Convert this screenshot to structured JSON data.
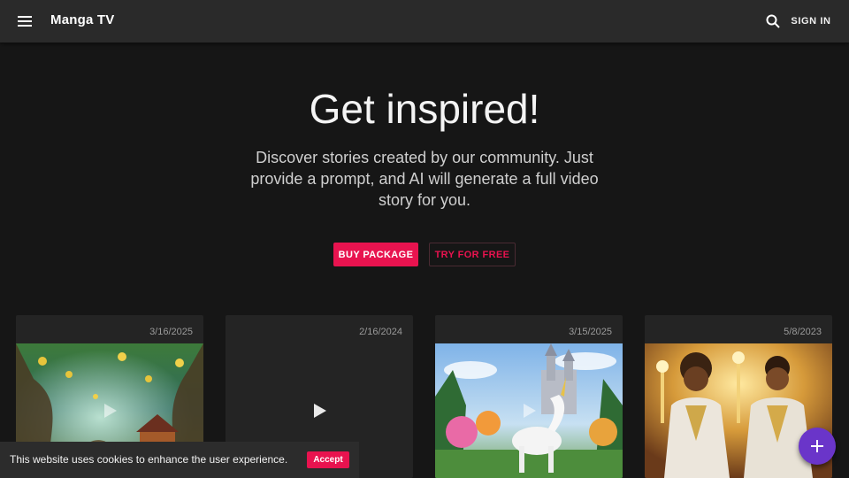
{
  "header": {
    "title": "Manga TV",
    "menu_icon": "menu-icon",
    "search_icon": "search-icon",
    "signin_label": "SIGN IN"
  },
  "hero": {
    "title": "Get inspired!",
    "subtitle": "Discover stories created by our community. Just provide a prompt, and AI will generate a full video story for you.",
    "buy_label": "BUY PACKAGE",
    "try_label": "TRY FOR FREE"
  },
  "cards": [
    {
      "date": "3/16/2025",
      "thumbnail": "enchanted-forest"
    },
    {
      "date": "2/16/2024",
      "thumbnail": "empty"
    },
    {
      "date": "3/15/2025",
      "thumbnail": "unicorn-castle"
    },
    {
      "date": "5/8/2023",
      "thumbnail": "two-warriors"
    }
  ],
  "cookie": {
    "text": "This website uses cookies to enhance the user experience.",
    "accept_label": "Accept"
  },
  "fab": {
    "icon": "plus-icon"
  },
  "colors": {
    "accent": "#e8134f",
    "fab": "#6a35c9",
    "appbar": "#2a2a2a",
    "background": "#161616",
    "card": "#242424"
  }
}
